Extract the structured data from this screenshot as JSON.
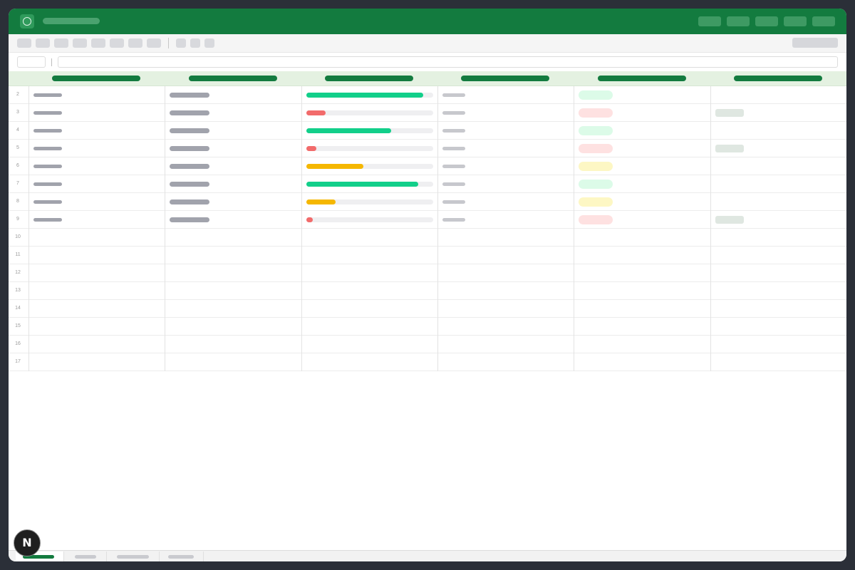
{
  "colors": {
    "brand": "#137b3f",
    "header_row": "#e4f1e1",
    "progress_green": "#12cf8a",
    "progress_red": "#f26b6b",
    "progress_yellow": "#f5b700",
    "badge_green": "#dcfbe8",
    "badge_red": "#fee1e1",
    "badge_yellow": "#fdf7c4"
  },
  "icons": {
    "app_logo": "circle-icon",
    "assistant_button": "N"
  },
  "grid": {
    "row_numbers": [
      "2",
      "3",
      "4",
      "5",
      "6",
      "7",
      "8",
      "9",
      "10",
      "11",
      "12",
      "13",
      "14",
      "15",
      "16",
      "17"
    ],
    "rows": [
      {
        "progress": 0.92,
        "status": "green",
        "has_tag": false
      },
      {
        "progress": 0.15,
        "status": "red",
        "has_tag": true
      },
      {
        "progress": 0.67,
        "status": "green",
        "has_tag": false
      },
      {
        "progress": 0.08,
        "status": "red",
        "has_tag": true
      },
      {
        "progress": 0.45,
        "status": "yellow",
        "has_tag": false
      },
      {
        "progress": 0.88,
        "status": "green",
        "has_tag": false
      },
      {
        "progress": 0.23,
        "status": "yellow",
        "has_tag": false
      },
      {
        "progress": 0.05,
        "status": "red",
        "has_tag": true
      }
    ]
  }
}
